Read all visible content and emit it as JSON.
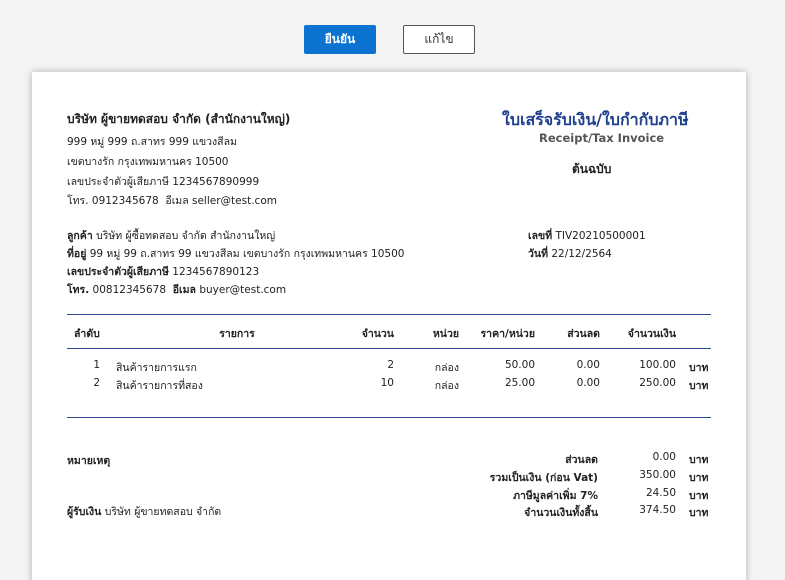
{
  "toolbar": {
    "confirm_label": "ยืนยัน",
    "edit_label": "แก้ไข"
  },
  "seller": {
    "name": "บริษัท ผู้ขายทดสอบ จำกัด (สำนักงานใหญ่)",
    "address1": "999 หมู่ 999 ถ.สาทร 999 แขวงสีลม",
    "address2": "เขตบางรัก  กรุงเทพมหานคร 10500",
    "tax_id_label": "เลขประจำตัวผู้เสียภาษี",
    "tax_id": "1234567890999",
    "phone_label": "โทร.",
    "phone": "0912345678",
    "email_label": "อีเมล",
    "email": "seller@test.com"
  },
  "document": {
    "title": "ใบเสร็จรับเงิน/ใบกำกับภาษี",
    "subtitle": "Receipt/Tax Invoice",
    "copy_type": "ต้นฉบับ",
    "number_label": "เลขที่",
    "number": "TIV20210500001",
    "date_label": "วันที่",
    "date": "22/12/2564"
  },
  "buyer": {
    "customer_label": "ลูกค้า",
    "customer": "บริษัท ผู้ซื้อทดสอบ จำกัด  สำนักงานใหญ่",
    "address_label": "ที่อยู่",
    "address": "99 หมู่ 99 ถ.สาทร 99 แขวงสีลม เขตบางรัก กรุงเทพมหานคร 10500",
    "tax_id_label": "เลขประจำตัวผู้เสียภาษี",
    "tax_id": "1234567890123",
    "phone_label": "โทร.",
    "phone": "00812345678",
    "email_label": "อีเมล",
    "email": "buyer@test.com"
  },
  "table": {
    "headers": {
      "no": "ลำดับ",
      "item": "รายการ",
      "qty": "จำนวน",
      "unit": "หน่วย",
      "price": "ราคา/หน่วย",
      "discount": "ส่วนลด",
      "amount": "จำนวนเงิน"
    },
    "rows": [
      {
        "no": "1",
        "item": "สินค้ารายการแรก",
        "qty": "2",
        "unit": "กล่อง",
        "price": "50.00",
        "discount": "0.00",
        "amount": "100.00",
        "currency": "บาท"
      },
      {
        "no": "2",
        "item": "สินค้ารายการที่สอง",
        "qty": "10",
        "unit": "กล่อง",
        "price": "25.00",
        "discount": "0.00",
        "amount": "250.00",
        "currency": "บาท"
      }
    ]
  },
  "footer": {
    "note_label": "หมายเหตุ",
    "receiver_label": "ผู้รับเงิน",
    "receiver": "บริษัท ผู้ขายทดสอบ จำกัด"
  },
  "summary": {
    "currency": "บาท",
    "discount_label": "ส่วนลด",
    "discount": "0.00",
    "subtotal_label": "รวมเป็นเงิน (ก่อน Vat)",
    "subtotal": "350.00",
    "vat_label": "ภาษีมูลค่าเพิ่ม 7%",
    "vat": "24.50",
    "total_label": "จำนวนเงินทั้งสิ้น",
    "total": "374.50"
  }
}
